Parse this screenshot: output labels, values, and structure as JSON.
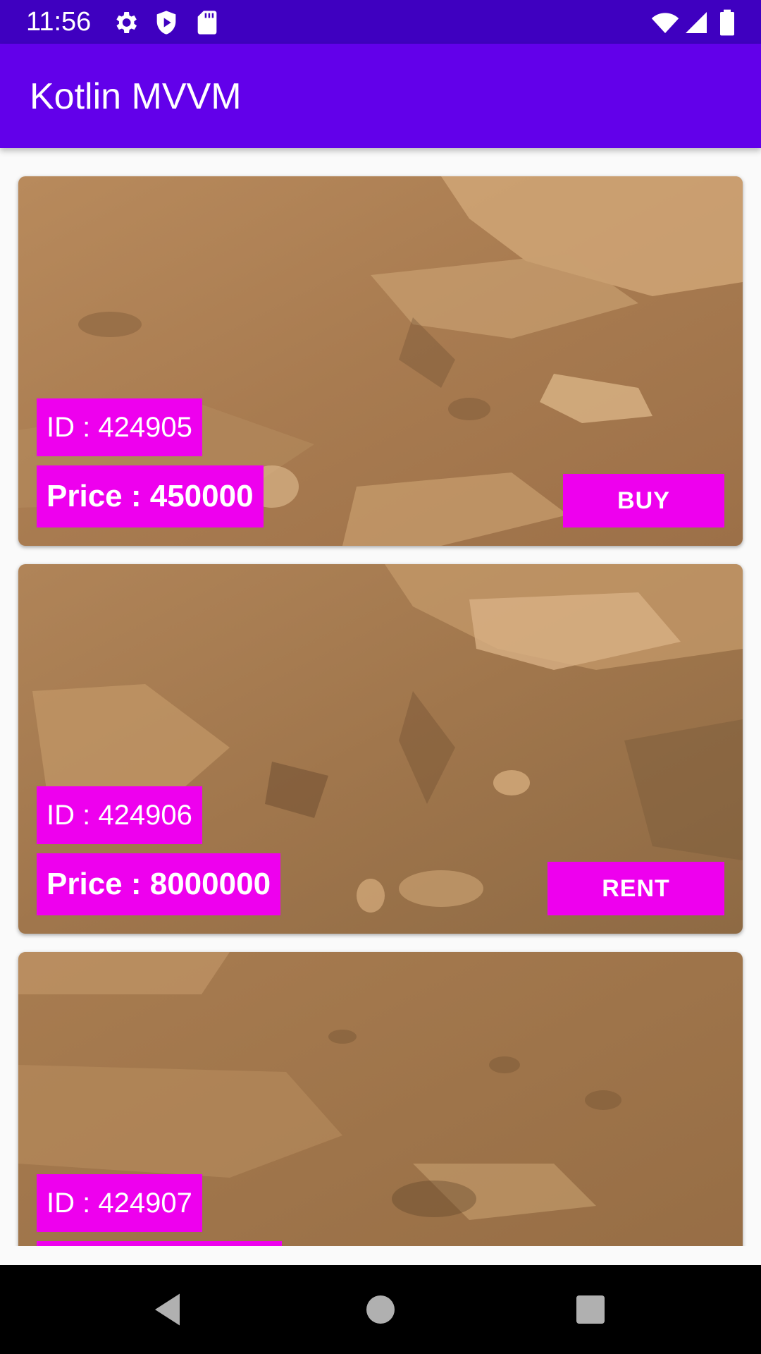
{
  "status_bar": {
    "time": "11:56",
    "icons": [
      "gear-icon",
      "shield-icon",
      "sd-card-icon",
      "wifi-icon",
      "signal-icon",
      "battery-icon"
    ]
  },
  "app_bar": {
    "title": "Kotlin MVVM"
  },
  "properties": [
    {
      "id_label": "ID : 424905",
      "price_label": "Price : 450000",
      "action_label": "BUY"
    },
    {
      "id_label": "ID : 424906",
      "price_label": "Price : 8000000",
      "action_label": "RENT"
    },
    {
      "id_label": "ID : 424907",
      "price_label": "",
      "action_label": ""
    }
  ],
  "colors": {
    "status_bar": "#3f00c0",
    "app_bar": "#6200ea",
    "label_accent": "#ee00ee",
    "nav_bar": "#000000"
  },
  "nav_bar": {
    "icons": [
      "back-icon",
      "home-icon",
      "recents-icon"
    ]
  }
}
